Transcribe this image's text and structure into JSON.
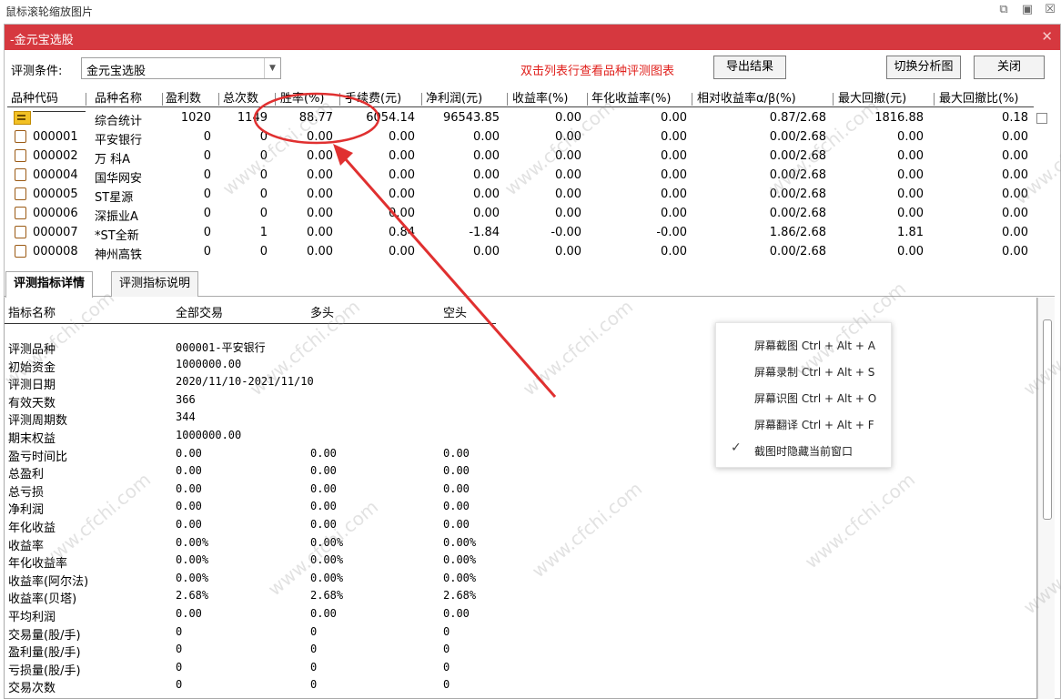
{
  "outer": {
    "title": "鼠标滚轮缩放图片"
  },
  "window": {
    "title": "-金元宝选股"
  },
  "toolbar": {
    "condition_label": "评测条件:",
    "condition_value": "金元宝选股",
    "hint": "双击列表行查看品种评测图表",
    "export_button": "导出结果",
    "switch_button": "切换分析图",
    "close_button": "关闭"
  },
  "grid": {
    "headers": [
      "品种代码",
      "品种名称",
      "盈利数",
      "总次数",
      "胜率(%)",
      "手续费(元)",
      "净利润(元)",
      "收益率(%)",
      "年化收益率(%)",
      "相对收益率α/β(%)",
      "最大回撤(元)",
      "最大回撤比(%)"
    ],
    "rows": [
      {
        "code": "",
        "name": "综合统计",
        "win": "1020",
        "total": "1149",
        "rate": "88.77",
        "fee": "6054.14",
        "profit": "96543.85",
        "ret": "0.00",
        "annual": "0.00",
        "rel": "0.87/2.68",
        "dd": "1816.88",
        "ddr": "0.18"
      },
      {
        "code": "000001",
        "name": "平安银行",
        "win": "0",
        "total": "0",
        "rate": "0.00",
        "fee": "0.00",
        "profit": "0.00",
        "ret": "0.00",
        "annual": "0.00",
        "rel": "0.00/2.68",
        "dd": "0.00",
        "ddr": "0.00"
      },
      {
        "code": "000002",
        "name": "万 科A",
        "win": "0",
        "total": "0",
        "rate": "0.00",
        "fee": "0.00",
        "profit": "0.00",
        "ret": "0.00",
        "annual": "0.00",
        "rel": "0.00/2.68",
        "dd": "0.00",
        "ddr": "0.00"
      },
      {
        "code": "000004",
        "name": "国华网安",
        "win": "0",
        "total": "0",
        "rate": "0.00",
        "fee": "0.00",
        "profit": "0.00",
        "ret": "0.00",
        "annual": "0.00",
        "rel": "0.00/2.68",
        "dd": "0.00",
        "ddr": "0.00"
      },
      {
        "code": "000005",
        "name": "ST星源",
        "win": "0",
        "total": "0",
        "rate": "0.00",
        "fee": "0.00",
        "profit": "0.00",
        "ret": "0.00",
        "annual": "0.00",
        "rel": "0.00/2.68",
        "dd": "0.00",
        "ddr": "0.00"
      },
      {
        "code": "000006",
        "name": "深振业A",
        "win": "0",
        "total": "0",
        "rate": "0.00",
        "fee": "0.00",
        "profit": "0.00",
        "ret": "0.00",
        "annual": "0.00",
        "rel": "0.00/2.68",
        "dd": "0.00",
        "ddr": "0.00"
      },
      {
        "code": "000007",
        "name": "*ST全新",
        "win": "0",
        "total": "1",
        "rate": "0.00",
        "fee": "0.84",
        "profit": "-1.84",
        "ret": "-0.00",
        "annual": "-0.00",
        "rel": "1.86/2.68",
        "dd": "1.81",
        "ddr": "0.00"
      },
      {
        "code": "000008",
        "name": "神州高铁",
        "win": "0",
        "total": "0",
        "rate": "0.00",
        "fee": "0.00",
        "profit": "0.00",
        "ret": "0.00",
        "annual": "0.00",
        "rel": "0.00/2.68",
        "dd": "0.00",
        "ddr": "0.00"
      }
    ]
  },
  "tabs": [
    "评测指标详情",
    "评测指标说明"
  ],
  "detail": {
    "headers": [
      "指标名称",
      "全部交易",
      "多头",
      "空头"
    ],
    "rows": [
      {
        "label": "评测品种",
        "all": "000001-平安银行",
        "long": "",
        "short": ""
      },
      {
        "label": "初始资金",
        "all": "1000000.00",
        "long": "",
        "short": ""
      },
      {
        "label": "评测日期",
        "all": "2020/11/10-2021/11/10",
        "long": "",
        "short": ""
      },
      {
        "label": "有效天数",
        "all": "366",
        "long": "",
        "short": ""
      },
      {
        "label": "评测周期数",
        "all": "344",
        "long": "",
        "short": ""
      },
      {
        "label": "期末权益",
        "all": "1000000.00",
        "long": "",
        "short": ""
      },
      {
        "label": "盈亏时间比",
        "all": "0.00",
        "long": "0.00",
        "short": "0.00"
      },
      {
        "label": "总盈利",
        "all": "0.00",
        "long": "0.00",
        "short": "0.00"
      },
      {
        "label": "总亏损",
        "all": "0.00",
        "long": "0.00",
        "short": "0.00"
      },
      {
        "label": "净利润",
        "all": "0.00",
        "long": "0.00",
        "short": "0.00"
      },
      {
        "label": "年化收益",
        "all": "0.00",
        "long": "0.00",
        "short": "0.00"
      },
      {
        "label": "收益率",
        "all": "0.00%",
        "long": "0.00%",
        "short": "0.00%"
      },
      {
        "label": "年化收益率",
        "all": "0.00%",
        "long": "0.00%",
        "short": "0.00%"
      },
      {
        "label": "收益率(阿尔法)",
        "all": "0.00%",
        "long": "0.00%",
        "short": "0.00%"
      },
      {
        "label": "收益率(贝塔)",
        "all": "2.68%",
        "long": "2.68%",
        "short": "2.68%"
      },
      {
        "label": "平均利润",
        "all": "0.00",
        "long": "0.00",
        "short": "0.00"
      },
      {
        "label": "交易量(股/手)",
        "all": "0",
        "long": "0",
        "short": "0"
      },
      {
        "label": "盈利量(股/手)",
        "all": "0",
        "long": "0",
        "short": "0"
      },
      {
        "label": "亏损量(股/手)",
        "all": "0",
        "long": "0",
        "short": "0"
      },
      {
        "label": "交易次数",
        "all": "0",
        "long": "0",
        "short": "0"
      }
    ]
  },
  "context_menu": {
    "items": [
      "屏幕截图 Ctrl + Alt + A",
      "屏幕录制 Ctrl + Alt + S",
      "屏幕识图 Ctrl + Alt + O",
      "屏幕翻译 Ctrl + Alt + F",
      "截图时隐藏当前窗口"
    ]
  },
  "watermark": "www.cfchi.com",
  "colors": {
    "title_bar": "#d6383f",
    "hint": "#e0201c",
    "annotation": "#e03030"
  }
}
